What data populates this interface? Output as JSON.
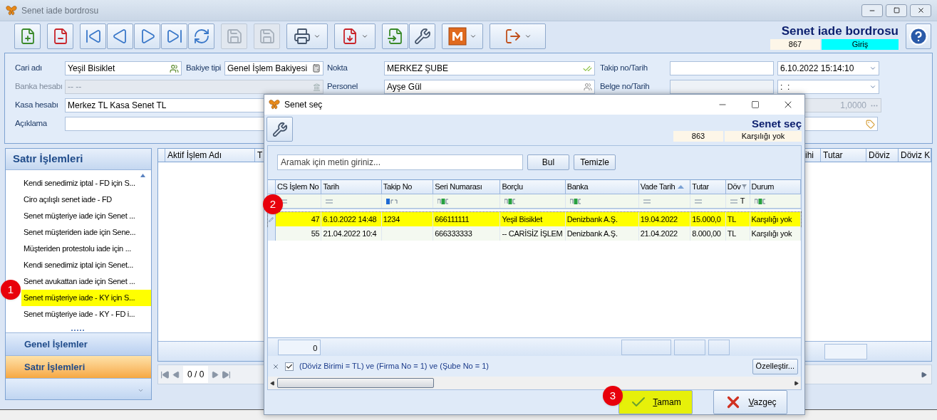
{
  "window": {
    "title": "Senet iade bordrosu"
  },
  "toolbar": [
    {
      "kind": "new",
      "disabled": false
    },
    {
      "kind": "delete",
      "disabled": false
    },
    {
      "kind": "first",
      "disabled": false
    },
    {
      "kind": "prev",
      "disabled": false
    },
    {
      "kind": "next",
      "disabled": false
    },
    {
      "kind": "last",
      "disabled": false
    },
    {
      "kind": "refresh",
      "disabled": false
    },
    {
      "kind": "save",
      "disabled": true
    },
    {
      "kind": "save_close",
      "disabled": true
    },
    {
      "kind": "print",
      "disabled": false
    },
    {
      "kind": "pdf",
      "disabled": false
    },
    {
      "kind": "import",
      "disabled": false
    },
    {
      "kind": "tools",
      "disabled": false
    },
    {
      "kind": "m",
      "disabled": false
    },
    {
      "kind": "exit",
      "disabled": false
    }
  ],
  "header": {
    "title": "Senet iade bordrosu",
    "number": "867",
    "mode": "Giriş"
  },
  "form": {
    "cari_adi": {
      "label": "Cari adı",
      "value": "Yeşil Bisiklet"
    },
    "bakiye_tipi": {
      "label": "Bakiye tipi",
      "value": "Genel İşlem Bakiyesi"
    },
    "nokta": {
      "label": "Nokta",
      "value": "MERKEZ ŞUBE"
    },
    "takip": {
      "label": "Takip no/Tarih",
      "date": "6.10.2022 15:14:10"
    },
    "banka_hesabi": {
      "label": "Banka hesabı",
      "value": "-- --",
      "disabled": true
    },
    "personel": {
      "label": "Personel",
      "value": "Ayşe Gül"
    },
    "belge": {
      "label": "Belge no/Tarih",
      "date": ":  :"
    },
    "kasa_hesabi": {
      "label": "Kasa hesabı",
      "value": "Merkez TL Kasa Senet TL"
    },
    "kur": {
      "value": "1,0000",
      "disabled": true
    },
    "aciklama": {
      "label": "Açıklama"
    }
  },
  "side_panel": {
    "title": "Satır İşlemleri",
    "items": [
      {
        "label": "Kendi senedimiz iptal - FD için S...",
        "selected": false
      },
      {
        "label": "Ciro açılışlı senet iade - FD",
        "selected": false
      },
      {
        "label": "Senet müşteriye iade için Senet ...",
        "selected": false
      },
      {
        "label": "Senet müşteriden iade için Sene...",
        "selected": false
      },
      {
        "label": "Müşteriden protestolu iade için ...",
        "selected": false
      },
      {
        "label": "Kendi senedimiz iptal için Senet...",
        "selected": false
      },
      {
        "label": "Senet avukattan iade için Senet ...",
        "selected": false
      },
      {
        "label": "Senet müşteriye iade - KY için S...",
        "selected": true
      },
      {
        "label": "Senet müşteriye iade - KY - FD i...",
        "selected": false
      }
    ],
    "nav": [
      {
        "label": "Genel İşlemler",
        "selected": false
      },
      {
        "label": "Satır İşlemleri",
        "selected": true
      }
    ]
  },
  "main_grid": {
    "columns": [
      "Aktif İşlem Adı",
      "T",
      "ihi",
      "Tutar",
      "Döviz",
      "Döviz K"
    ],
    "pager": "0 / 0"
  },
  "dialog": {
    "title": "Senet seç",
    "header": {
      "title": "Senet seç",
      "number": "863",
      "status": "Karşılığı yok"
    },
    "search": {
      "placeholder": "Aramak için metin giriniz..."
    },
    "search_buttons": [
      "Bul",
      "Temizle"
    ],
    "columns": [
      {
        "label": "CS İşlem No",
        "kind": "equals",
        "sorted": false,
        "filtered": false
      },
      {
        "label": "Tarih",
        "kind": "equals",
        "sorted": false,
        "filtered": false
      },
      {
        "label": "Takip No",
        "kind": "text_start",
        "sorted": false,
        "filtered": false
      },
      {
        "label": "Seri Numarası",
        "kind": "text",
        "sorted": false,
        "filtered": false
      },
      {
        "label": "Borçlu",
        "kind": "text",
        "sorted": false,
        "filtered": false
      },
      {
        "label": "Banka",
        "kind": "text",
        "sorted": false,
        "filtered": false
      },
      {
        "label": "Vade Tarih",
        "kind": "equals",
        "sorted": true,
        "filtered": false
      },
      {
        "label": "Tutar",
        "kind": "equals",
        "sorted": false,
        "filtered": false
      },
      {
        "label": "Döv",
        "kind": "equals",
        "filter_value": "T",
        "sorted": false,
        "filtered": true
      },
      {
        "label": "Durum",
        "kind": "text",
        "sorted": false,
        "filtered": false
      }
    ],
    "rows": [
      {
        "cells": [
          "47",
          "6.10.2022 14:48",
          "1234",
          "666111111",
          "Yeşil Bisiklet",
          "Denizbank A.Ş.",
          "19.04.2022",
          "15.000,0",
          "TL",
          "Karşılığı yok"
        ],
        "selected": true
      },
      {
        "cells": [
          "55",
          "21.04.2022 10:4",
          "",
          "666333333",
          "-- CARİSİZ İŞLEM",
          "Denizbank A.Ş.",
          "21.04.2022",
          "8.000,00",
          "TL",
          "Karşılığı yok"
        ],
        "selected": false
      }
    ],
    "summary": "0",
    "filter_bar": {
      "enabled": true,
      "text": "(Döviz Birimi = TL) ve (Firma No = 1) ve (Şube No = 1)",
      "button": "Özelleştir..."
    },
    "ok": {
      "label": "Tamam",
      "highlighted": true
    },
    "cancel": {
      "label": "Vazgeç",
      "highlighted": false
    }
  },
  "annotations": [
    {
      "label": "1"
    },
    {
      "label": "2"
    },
    {
      "label": "3"
    }
  ]
}
